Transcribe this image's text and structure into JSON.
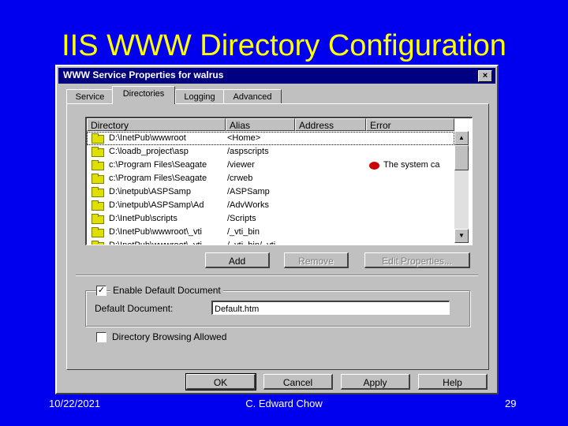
{
  "slide": {
    "title": "IIS WWW Directory Configuration",
    "date": "10/22/2021",
    "author": "C. Edward Chow",
    "page": "29"
  },
  "dialog": {
    "title": "WWW Service Properties for walrus",
    "close": "×",
    "tabs": [
      {
        "label": "Service",
        "active": false
      },
      {
        "label": "Directories",
        "active": true
      },
      {
        "label": "Logging",
        "active": false
      },
      {
        "label": "Advanced",
        "active": false
      }
    ],
    "list": {
      "columns": [
        "Directory",
        "Alias",
        "Address",
        "Error"
      ],
      "rows": [
        {
          "directory": "D:\\InetPub\\wwwroot",
          "alias": "<Home>",
          "address": "",
          "error": "",
          "icon": "home-folder-icon"
        },
        {
          "directory": "C:\\loadb_project\\asp",
          "alias": "/aspscripts",
          "address": "",
          "error": "",
          "icon": "folder-icon"
        },
        {
          "directory": "c:\\Program Files\\Seagate",
          "alias": "/viewer",
          "address": "",
          "error": "The system ca",
          "icon": "folder-icon"
        },
        {
          "directory": "c:\\Program Files\\Seagate",
          "alias": "/crweb",
          "address": "",
          "error": "",
          "icon": "folder-icon"
        },
        {
          "directory": "D:\\inetpub\\ASPSamp",
          "alias": "/ASPSamp",
          "address": "",
          "error": "",
          "icon": "folder-icon"
        },
        {
          "directory": "D:\\inetpub\\ASPSamp\\Ad",
          "alias": "/AdvWorks",
          "address": "",
          "error": "",
          "icon": "folder-icon"
        },
        {
          "directory": "D:\\InetPub\\scripts",
          "alias": "/Scripts",
          "address": "",
          "error": "",
          "icon": "folder-icon"
        },
        {
          "directory": "D:\\InetPub\\wwwroot\\_vti",
          "alias": "/_vti_bin",
          "address": "",
          "error": "",
          "icon": "folder-icon"
        },
        {
          "directory": "D:\\InetPub\\wwwroot\\_vti",
          "alias": "/_vti_bin/_vti",
          "address": "",
          "error": "",
          "icon": "folder-icon"
        }
      ]
    },
    "buttons": {
      "add": "Add",
      "remove": "Remove",
      "edit": "Edit Properties..."
    },
    "default_doc": {
      "checkbox_label": "Enable Default Document",
      "checked": "✓",
      "field_label": "Default Document:",
      "value": "Default.htm"
    },
    "browsing": {
      "label": "Directory Browsing Allowed"
    },
    "footer_buttons": {
      "ok": "OK",
      "cancel": "Cancel",
      "apply": "Apply",
      "help": "Help"
    },
    "scroll": {
      "up": "▲",
      "down": "▼"
    }
  }
}
